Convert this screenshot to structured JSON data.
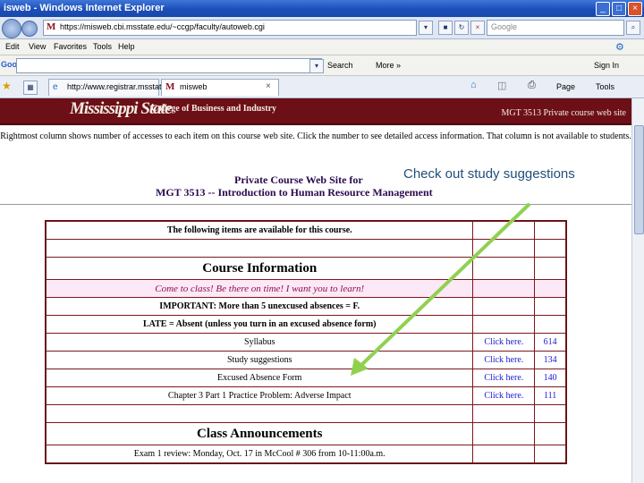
{
  "window": {
    "title": "isweb - Windows Internet Explorer",
    "colors": {
      "titlebar": "#1c4fb8",
      "banner": "#6d0f16",
      "callout": "#1f4e79",
      "arrow": "#8fd14f"
    }
  },
  "address_bar": {
    "favicon_letter": "M",
    "url": "https://misweb.cbi.msstate.edu/~ccgp/faculty/autoweb.cgi",
    "search_placeholder": "Google"
  },
  "menu": [
    "Edit",
    "View",
    "Favorites",
    "Tools",
    "Help"
  ],
  "google_toolbar": {
    "logo": "Google",
    "search_label": "Search",
    "more_label": "More »",
    "sign_in_label": "Sign In"
  },
  "tabs": [
    {
      "label": "http://www.registrar.msstate...",
      "active": false
    },
    {
      "label": "misweb",
      "active": true
    }
  ],
  "toolbar_right": {
    "page_label": "Page",
    "tools_label": "Tools"
  },
  "page": {
    "logo_text": "Mississippi State",
    "college": "College of Business and Industry",
    "course_site": "MGT 3513 Private course web site",
    "note": "Rightmost column shows number of accesses to each item on this course web site. Click the number to see detailed access information. That column is not available to students.",
    "heading1": "Private Course Web Site for",
    "heading2": "MGT 3513 -- Introduction to Human Resource Management",
    "callout": "Check out study suggestions",
    "table": {
      "header": "The following items are available for this course.",
      "section1": "Course Information",
      "notice": "Come to class! Be there on time! I want you to learn!",
      "important": "IMPORTANT: More than 5 unexcused absences = F.",
      "late": "LATE = Absent (unless you turn in an excused absence form)",
      "items": [
        {
          "title": "Syllabus",
          "link": "Click here.",
          "count": "614"
        },
        {
          "title": "Study suggestions",
          "link": "Click here.",
          "count": "134"
        },
        {
          "title": "Excused Absence Form",
          "link": "Click here.",
          "count": "140"
        },
        {
          "title": "Chapter 3 Part 1 Practice Problem: Adverse Impact",
          "link": "Click here.",
          "count": "111"
        }
      ],
      "section2": "Class Announcements",
      "announcement": "Exam 1 review: Monday, Oct. 17 in McCool # 306 from 10-11:00a.m."
    }
  }
}
